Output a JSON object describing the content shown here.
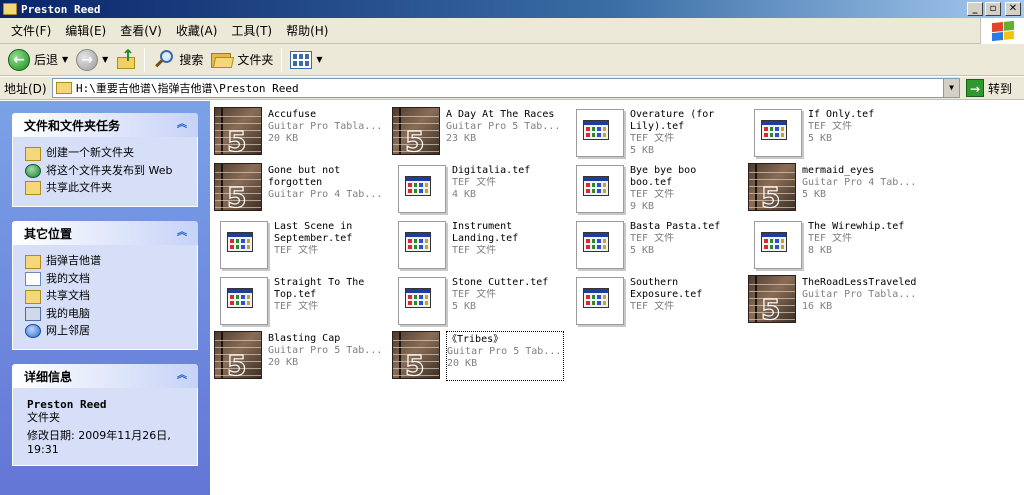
{
  "window": {
    "title": "Preston Reed"
  },
  "menu": [
    "文件(F)",
    "编辑(E)",
    "查看(V)",
    "收藏(A)",
    "工具(T)",
    "帮助(H)"
  ],
  "toolbar": {
    "back": "后退",
    "search": "搜索",
    "folders": "文件夹"
  },
  "address": {
    "label": "地址(D)",
    "path": "H:\\重要吉他谱\\指弹吉他谱\\Preston Reed",
    "go": "转到"
  },
  "tasks": {
    "title": "文件和文件夹任务",
    "items": [
      "创建一个新文件夹",
      "将这个文件夹发布到 Web",
      "共享此文件夹"
    ]
  },
  "places": {
    "title": "其它位置",
    "items": [
      "指弹吉他谱",
      "我的文档",
      "共享文档",
      "我的电脑",
      "网上邻居"
    ]
  },
  "details": {
    "title": "详细信息",
    "name": "Preston Reed",
    "type": "文件夹",
    "modified": "修改日期: 2009年11月26日, 19:31"
  },
  "files": [
    {
      "name": "Accufuse",
      "type": "Guitar Pro Tabla...",
      "size": "20 KB",
      "kind": "gp"
    },
    {
      "name": "A Day At The Races",
      "type": "Guitar Pro 5 Tab...",
      "size": "23 KB",
      "kind": "gp"
    },
    {
      "name": "Overature (for Lily).tef",
      "type": "TEF 文件",
      "size": "5 KB",
      "kind": "tef"
    },
    {
      "name": "If Only.tef",
      "type": "TEF 文件",
      "size": "5 KB",
      "kind": "tef"
    },
    {
      "name": "Gone but not forgotten",
      "type": "Guitar Pro 4 Tab...",
      "size": "",
      "kind": "gp"
    },
    {
      "name": "Digitalia.tef",
      "type": "TEF 文件",
      "size": "4 KB",
      "kind": "tef"
    },
    {
      "name": "Bye bye boo boo.tef",
      "type": "TEF 文件",
      "size": "9 KB",
      "kind": "tef"
    },
    {
      "name": "mermaid_eyes",
      "type": "Guitar Pro 4 Tab...",
      "size": "5 KB",
      "kind": "gp"
    },
    {
      "name": "Last Scene in September.tef",
      "type": "TEF 文件",
      "size": "",
      "kind": "tef"
    },
    {
      "name": "Instrument Landing.tef",
      "type": "TEF 文件",
      "size": "",
      "kind": "tef"
    },
    {
      "name": "Basta Pasta.tef",
      "type": "TEF 文件",
      "size": "5 KB",
      "kind": "tef"
    },
    {
      "name": "The Wirewhip.tef",
      "type": "TEF 文件",
      "size": "8 KB",
      "kind": "tef"
    },
    {
      "name": "Straight To The Top.tef",
      "type": "TEF 文件",
      "size": "",
      "kind": "tef"
    },
    {
      "name": "Stone Cutter.tef",
      "type": "TEF 文件",
      "size": "5 KB",
      "kind": "tef"
    },
    {
      "name": "Southern Exposure.tef",
      "type": "TEF 文件",
      "size": "",
      "kind": "tef"
    },
    {
      "name": "TheRoadLessTraveled",
      "type": "Guitar Pro Tabla...",
      "size": "16 KB",
      "kind": "gp"
    },
    {
      "name": "Blasting Cap",
      "type": "Guitar Pro 5 Tab...",
      "size": "20 KB",
      "kind": "gp"
    },
    {
      "name": "《Tribes》",
      "type": "Guitar Pro 5 Tab...",
      "size": "20 KB",
      "kind": "gp",
      "selected": true
    }
  ]
}
